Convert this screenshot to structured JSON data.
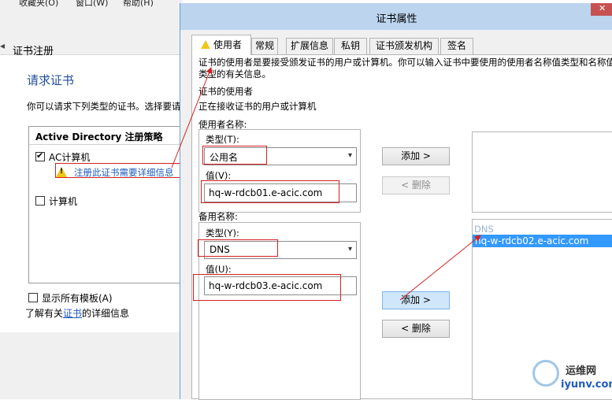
{
  "background_window": {
    "menubar": [
      "收藏夹(O)",
      "窗口(W)",
      "帮助(H)"
    ],
    "title": "证书注册",
    "heading": "请求证书",
    "description": "你可以请求下列类型的证书。选择要请",
    "policy_title": "Active Directory 注册策略",
    "item_ac_label": "AC计算机",
    "item_ac_checked": true,
    "warning_link": "注册此证书需要详细信息",
    "item_computer_label": "计算机",
    "item_computer_checked": false,
    "show_all_label": "显示所有模板(A)",
    "learn_more_prefix": "了解有关",
    "learn_more_link": "证书",
    "learn_more_suffix": "的详细信息"
  },
  "dialog": {
    "title": "证书属性",
    "close_icon": "close-icon",
    "tabs": [
      "使用者",
      "常规",
      "扩展信息",
      "私钥",
      "证书颁发机构",
      "签名"
    ],
    "active_tab": 0,
    "intro": "证书的使用者是要接受颁发证书的用户或计算机。你可以输入证书中要使用的使用者名称值类型和名称值类型的有关信息。",
    "subject_heading": "证书的使用者",
    "subject_desc": "正在接收证书的用户或计算机",
    "subject_name_label": "使用者名称:",
    "subject_type_label": "类型(T):",
    "subject_type_value": "公用名",
    "subject_value_label": "值(V):",
    "subject_value": "hq-w-rdcb01.e-acic.com",
    "alt_name_label": "备用名称:",
    "alt_type_label": "类型(Y):",
    "alt_type_value": "DNS",
    "alt_value_label": "值(U):",
    "alt_value": "hq-w-rdcb03.e-acic.com",
    "add_button": "添加 >",
    "remove_button": "< 删除",
    "alt_list_group": "DNS",
    "alt_list_items": [
      "hq-w-rdcb02.e-acic.com"
    ]
  },
  "watermark": {
    "line1": "运维网",
    "line2": "iyunv.com"
  },
  "colors": {
    "annotation_red": "#d42020",
    "selection_blue": "#3399ff",
    "title_bar": "#bcd4ee"
  }
}
